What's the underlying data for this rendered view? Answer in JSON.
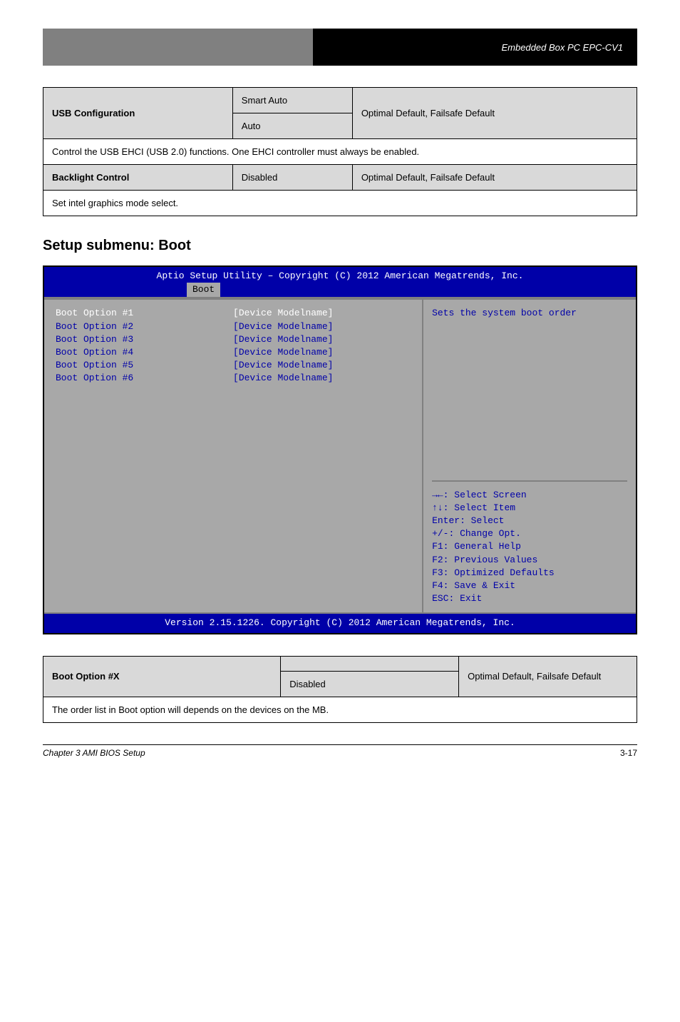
{
  "header": {
    "product": "Embedded Box PC EPC-CV1"
  },
  "table1": {
    "r1c1": "USB Configuration",
    "r1c2": "Smart Auto",
    "r1c3": "Optimal Default, Failsafe Default",
    "r1c4": "Auto",
    "r2": "Control the USB EHCI (USB 2.0) functions. One EHCI controller must always be enabled.",
    "r3c1": "Backlight Control",
    "r3c2": "Disabled",
    "r3c3": "Optimal Default, Failsafe Default",
    "r4": "Set intel graphics mode select."
  },
  "sectionTitle": "Setup submenu: Boot",
  "bios": {
    "title": "Aptio Setup Utility – Copyright (C) 2012 American Megatrends, Inc.",
    "tab": "Boot",
    "items": [
      {
        "label": "Boot Option #1",
        "value": "[Device Modelname]",
        "selected": true
      },
      {
        "label": "Boot Option #2",
        "value": "[Device Modelname]",
        "selected": false
      },
      {
        "label": "Boot Option #3",
        "value": "[Device Modelname]",
        "selected": false
      },
      {
        "label": "Boot Option #4",
        "value": "[Device Modelname]",
        "selected": false
      },
      {
        "label": "Boot Option #5",
        "value": "[Device Modelname]",
        "selected": false
      },
      {
        "label": "Boot Option #6",
        "value": "[Device Modelname]",
        "selected": false
      }
    ],
    "helpTop": "Sets the system boot order",
    "helpBottom": [
      "→←: Select Screen",
      "↑↓: Select Item",
      "Enter: Select",
      "+/-: Change Opt.",
      "F1: General Help",
      "F2: Previous Values",
      "F3: Optimized Defaults",
      "F4: Save & Exit",
      "ESC: Exit"
    ],
    "footer": "Version 2.15.1226. Copyright (C) 2012 American Megatrends, Inc."
  },
  "table2": {
    "r1c1": "Boot Option #X",
    "r1c2": "",
    "r1c3": "Optimal Default, Failsafe Default",
    "r1c4": "Disabled",
    "r2": "The order list in Boot option will depends on the devices on the MB."
  },
  "footer": {
    "left": "Chapter 3 AMI BIOS Setup",
    "right": "3-17"
  }
}
